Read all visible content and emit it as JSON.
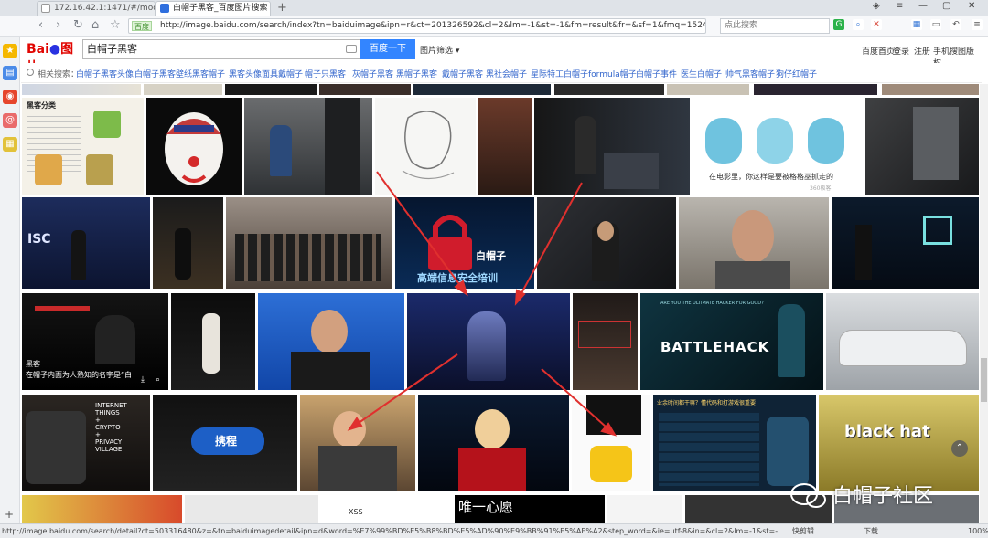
{
  "browser": {
    "tabs": [
      {
        "title": "172.16.42.1:1471/#/modules/..."
      },
      {
        "title": "白帽子黑客_百度图片搜索"
      }
    ],
    "new_tab": "+",
    "url": "http://image.baidu.com/search/index?tn=baiduimage&ipn=r&ct=201326592&cl=2&lm=-1&st=-1&fm=result&fr=&sf=1&fmq=15248286",
    "secure_badge": "百度",
    "search_placeholder": "点此搜索"
  },
  "baidu": {
    "logo": "Bai 图片",
    "query": "白帽子黑客",
    "search_button": "百度一下",
    "filter_label": "图片筛选",
    "top_links": [
      "百度首页",
      "登录",
      "注册",
      "手机搜图",
      "版权"
    ]
  },
  "related": {
    "label": "相关搜索：",
    "items": [
      "白帽子黑客头像",
      "白帽子黑客壁纸",
      "黑客帽子",
      "黑客头像面具戴帽子",
      "帽子只黑客",
      "灰帽子黑客",
      "黑帽子黑客",
      "戴帽子黑客",
      "黑社会帽子",
      "星际特工白帽子",
      "formula帽子",
      "白帽子事件",
      "医生白帽子",
      "帅气黑客帽子",
      "狗仔红帽子"
    ]
  },
  "images": {
    "row1_caption": "黑客分类",
    "meme_caption": "在电影里，你这样是要被格格巫抓走的",
    "meme_source": "360极客",
    "lock_caption_1": "白帽子",
    "lock_caption_2": "高端信息安全培训",
    "isc_label": "ISC",
    "hover_caption_1": "黑客",
    "hover_caption_2": "在帽子内面为人熟知的名字是“白",
    "battlehack_q": "ARE YOU THE ULTIMATE HACKER FOR GOOD?",
    "battlehack": "BATTLEHACK",
    "iot_text": "INTERNET\nTHINGS\n+\nCRYPTO\n+\nPRIVACY\nVILLAGE",
    "ctrip": "携程",
    "chart_title": "业余时间都干嘛？懂代码和打游戏很重要",
    "blackhat": "black hat",
    "bottom_text": "唯一心愿",
    "xss": "XSS"
  },
  "watermark": "白帽子社区",
  "status": {
    "url": "http://image.baidu.com/search/detail?ct=503316480&z=&tn=baiduimagedetail&ipn=d&word=%E7%99%BD%E5%B8%BD%E5%AD%90%E9%BB%91%E5%AE%A2&step_word=&ie=utf-8&in=&cl=2&lm=-1&st=-1&cs=1396072484,3882199901&os=2512987652",
    "items": [
      "快剪辑",
      "下载",
      "100%"
    ]
  }
}
